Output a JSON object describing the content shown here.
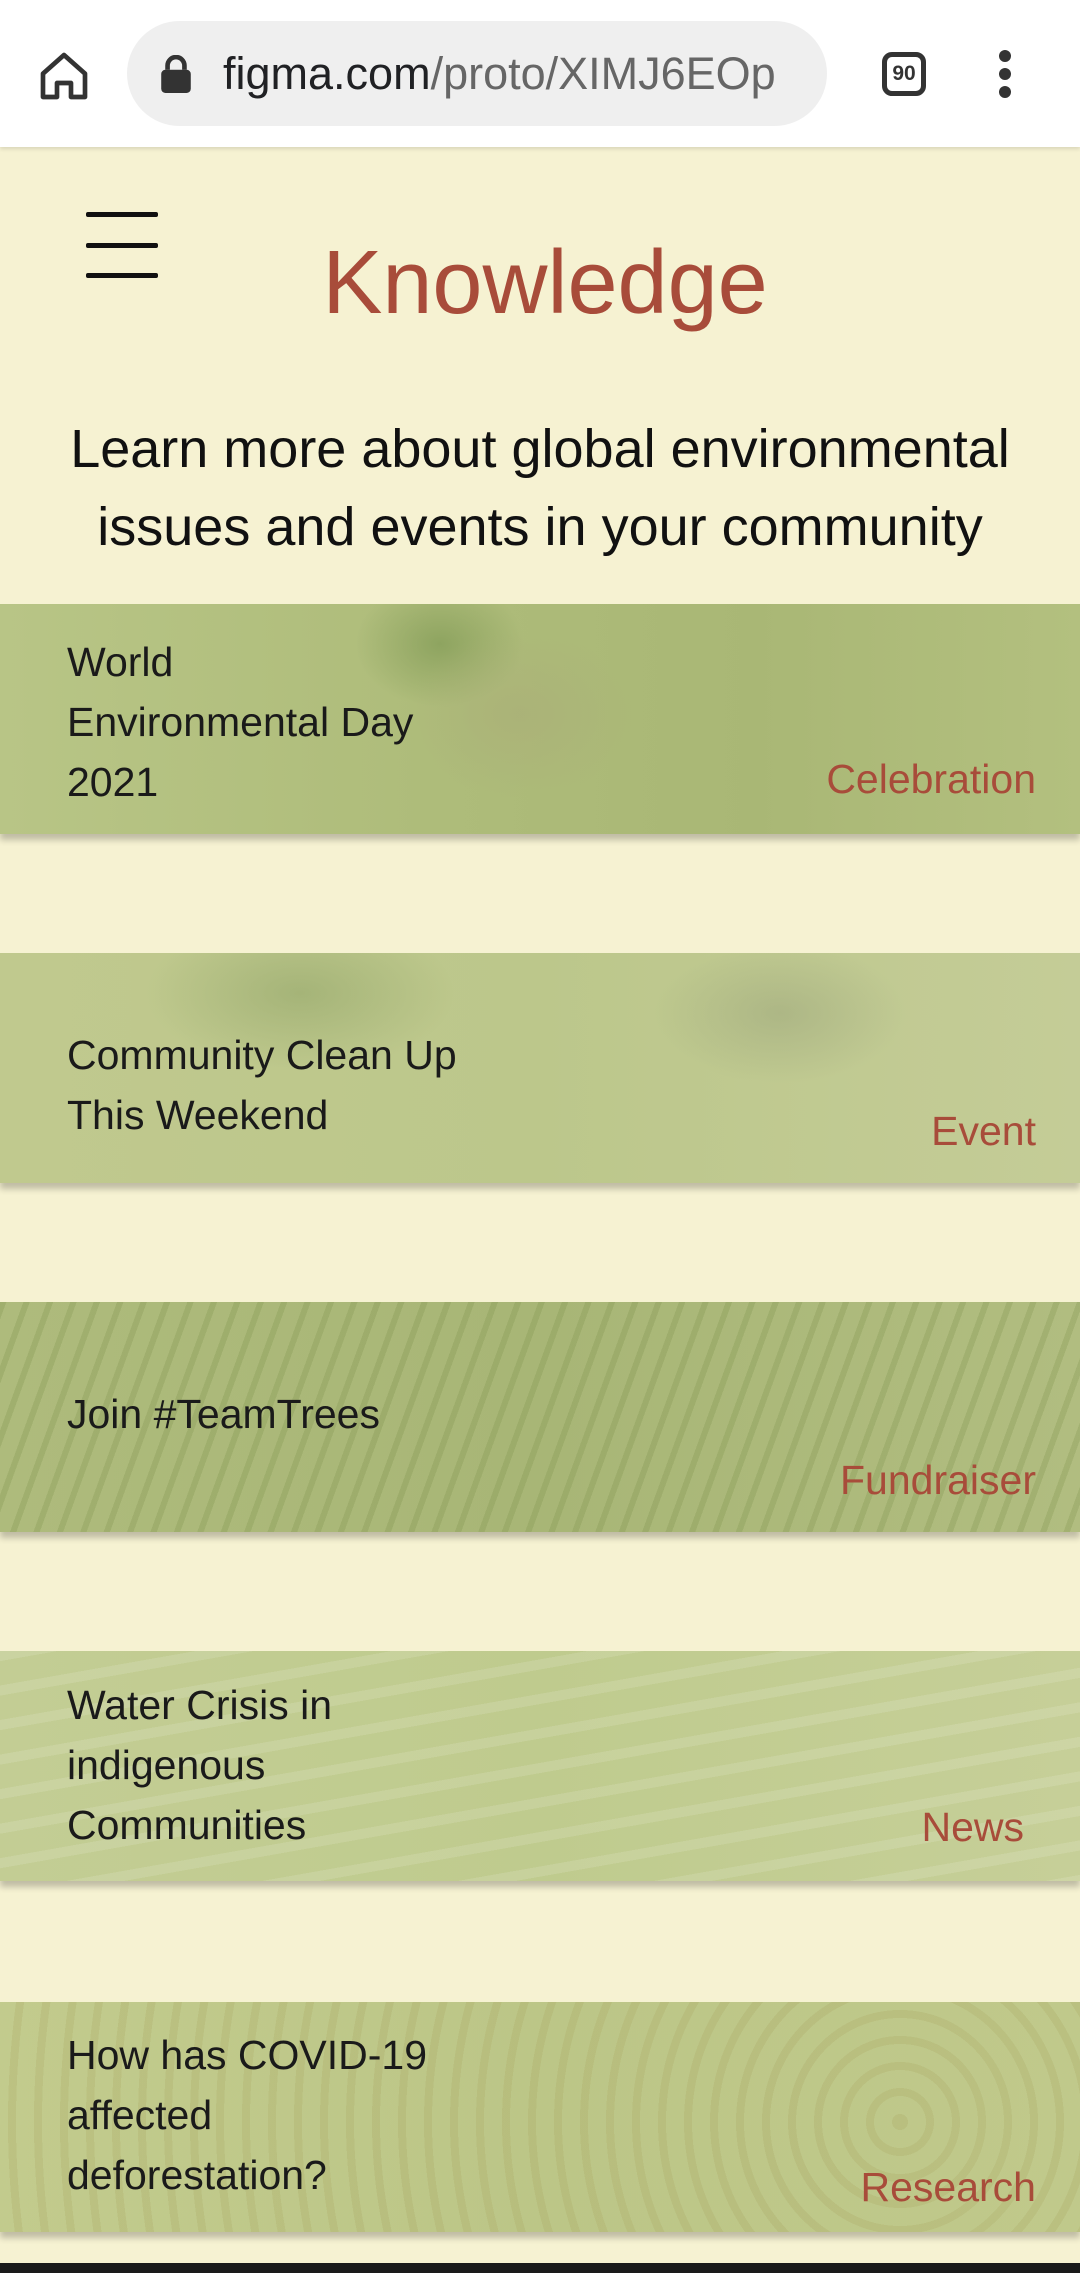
{
  "browser": {
    "url_domain": "figma.com",
    "url_path": "/proto/XIMJ6EOp",
    "tab_count": "90",
    "icons": [
      "home-icon",
      "lock-icon",
      "tab-switcher-icon",
      "more-vert-icon"
    ]
  },
  "page": {
    "title": "Knowledge",
    "subtitle": "Learn more about global environmental issues and events in your community",
    "menu_icon": "hamburger-menu-icon"
  },
  "cards": [
    {
      "title": "World\nEnvironmental Day\n2021",
      "tag": "Celebration"
    },
    {
      "title": "Community Clean Up\nThis Weekend",
      "tag": "Event"
    },
    {
      "title": "Join #TeamTrees",
      "tag": "Fundraiser"
    },
    {
      "title": "Water Crisis in\nindigenous\nCommunities",
      "tag": "News"
    },
    {
      "title": "How has COVID-19\naffected\ndeforestation?",
      "tag": "Research"
    }
  ],
  "colors": {
    "background": "#f6f2d2",
    "accent": "#a84c3a",
    "card_green": "#b6c283"
  }
}
